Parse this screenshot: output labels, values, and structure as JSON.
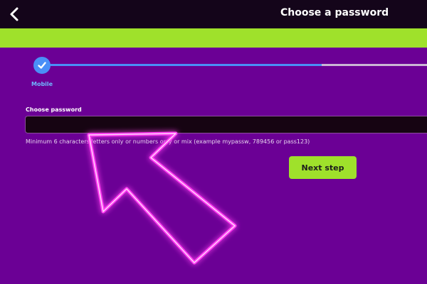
{
  "header": {
    "title": "Choose a password",
    "back_icon": "chevron-left-icon"
  },
  "stepper": {
    "steps": [
      {
        "label": "Mobile",
        "icon": "checkmark-icon",
        "state": "completed"
      }
    ],
    "progress_percent": 72
  },
  "form": {
    "password_label": "Choose password",
    "password_value": "",
    "hint": "Minimum 6 characters letters only or numbers only or mix (example mypassw, 789456 or pass123)",
    "next_button_label": "Next step"
  },
  "overlay": {
    "icon": "neon-arrow-pointer-icon"
  },
  "colors": {
    "background": "#6b0095",
    "topbar": "#14051a",
    "accent": "#9fe12b",
    "progress": "#4a8ff7",
    "neon_arrow": "#ff3cf2"
  }
}
